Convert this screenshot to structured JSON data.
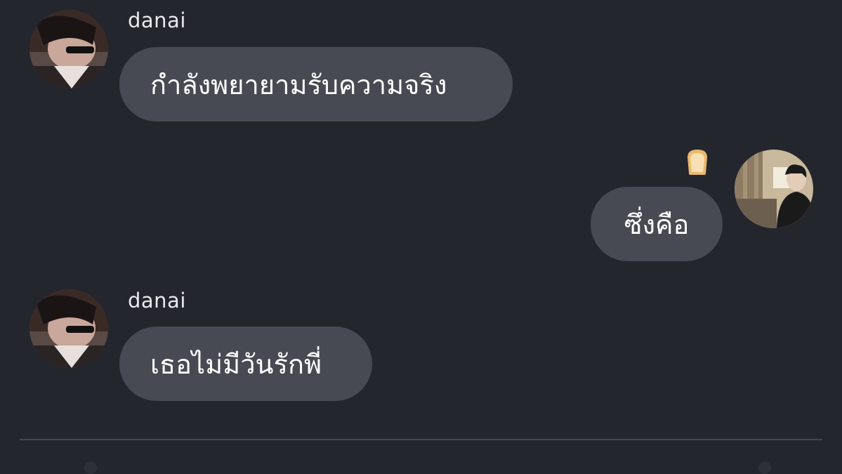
{
  "messages": [
    {
      "sender": "danai",
      "text": "กำลังพยายามรับความจริง",
      "direction": "incoming"
    },
    {
      "sender": "",
      "text": "ซึ่งคือ",
      "direction": "outgoing",
      "reaction_icon": "bread-icon"
    },
    {
      "sender": "danai",
      "text": "เธอไม่มีวันรักพี่",
      "direction": "incoming"
    }
  ],
  "colors": {
    "background": "#24262e",
    "bubble": "#474a53",
    "divider": "#45474f"
  }
}
